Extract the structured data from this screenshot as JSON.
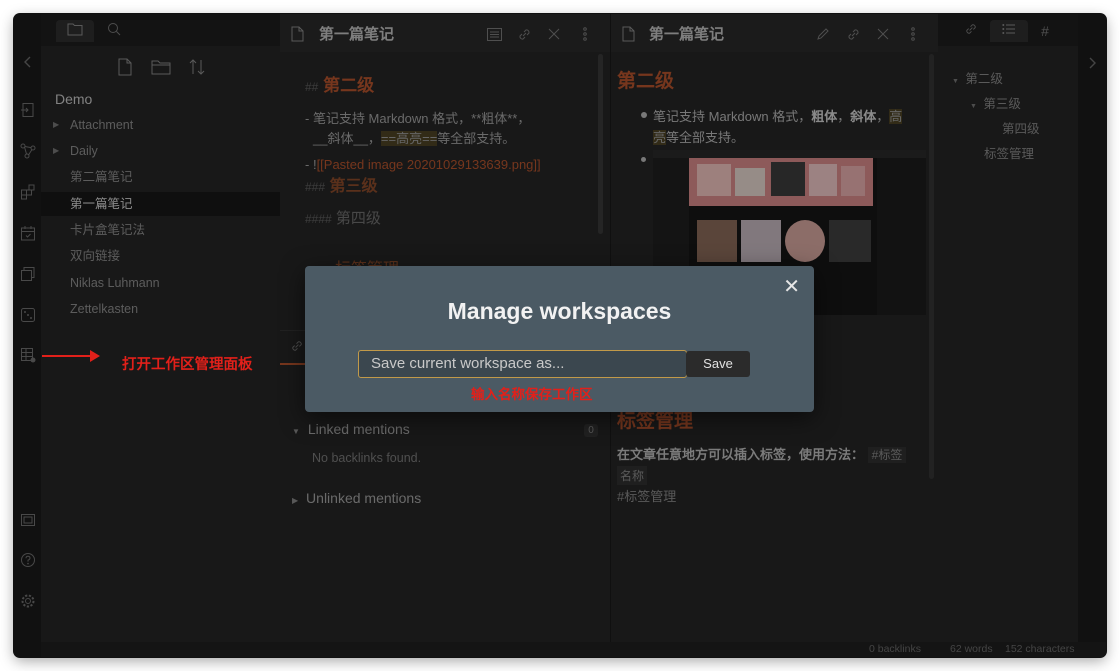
{
  "explorer": {
    "vault_name": "Demo",
    "items": [
      {
        "label": "Attachment",
        "folder": true
      },
      {
        "label": "Daily",
        "folder": true
      },
      {
        "label": "第二篇笔记",
        "folder": false
      },
      {
        "label": "第一篇笔记",
        "folder": false,
        "selected": true
      },
      {
        "label": "卡片盒笔记法",
        "folder": false
      },
      {
        "label": "双向链接",
        "folder": false
      },
      {
        "label": "Niklas Luhmann",
        "folder": false
      },
      {
        "label": "Zettelkasten",
        "folder": false
      }
    ]
  },
  "left_pane": {
    "title": "第一篇笔记",
    "h2_mark": "##",
    "h2": "第二级",
    "line1": "- 笔记支持 Markdown 格式，**粗体**，",
    "line2a": "__斜体__，",
    "line2b": "==高亮==",
    "line2c": "等全部支持。",
    "line3a": "- !",
    "line3b": "[[Pasted image 20201029133639.png]]",
    "h3_mark": "###",
    "h3": "第三级",
    "h4_mark": "####",
    "h4": "第四级",
    "partial": "标签管理"
  },
  "backlinks": {
    "linked_label": "Linked mentions",
    "linked_count": "0",
    "no_backlinks": "No backlinks found.",
    "unlinked_label": "Unlinked mentions"
  },
  "right_pane": {
    "title": "第一篇笔记",
    "h2": "第二级",
    "bullet1a": "笔记支持 Markdown 格式，",
    "bullet1b": "粗体",
    "bullet1c": "，",
    "bullet1d": "斜体",
    "bullet1e": "，",
    "bullet1f": "高",
    "bullet1g": "亮",
    "bullet1h": "等全部支持。",
    "partial_heading": "标签管理",
    "para1": "在文章任意地方可以插入标签，使用方法：",
    "tag_code1": "#标签",
    "tag_code2": "名称",
    "tag_plain": "#标签管理"
  },
  "outline": {
    "items": [
      "第二级",
      "第三级",
      "第四级",
      "标签管理"
    ]
  },
  "status": {
    "backlinks": "0 backlinks",
    "words": "62 words",
    "chars": "152 characters"
  },
  "modal": {
    "title": "Manage workspaces",
    "placeholder": "Save current workspace as...",
    "save": "Save",
    "close": "✕"
  },
  "annotations": {
    "left": "打开工作区管理面板",
    "below_input": "输入名称保存工作区"
  },
  "colors": {
    "accent_orange": "#b5542d",
    "annotation_red": "#e2201a",
    "modal_bg": "#4b5a64",
    "input_border": "#c29a49"
  }
}
